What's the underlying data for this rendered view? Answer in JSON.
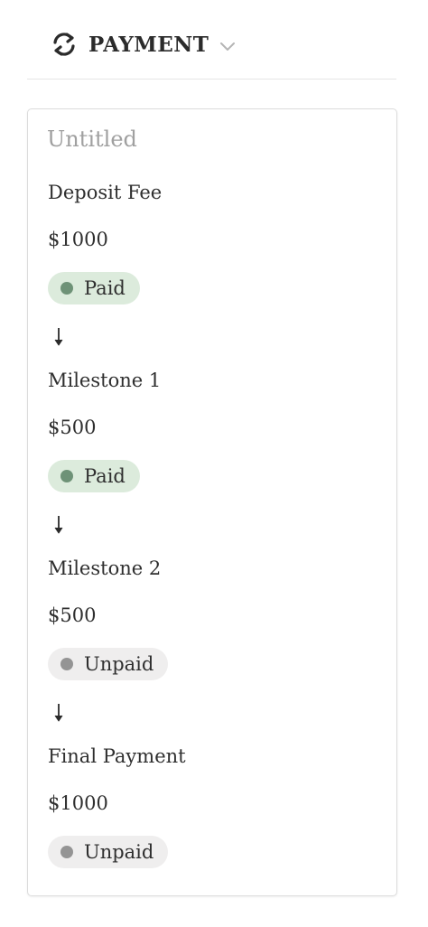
{
  "header": {
    "title": "PAYMENT",
    "icon": "sync-icon",
    "dropdown_icon": "chevron-down-icon"
  },
  "card": {
    "title": "Untitled",
    "steps": [
      {
        "label": "Deposit Fee",
        "amount": "$1000",
        "status": "Paid"
      },
      {
        "label": "Milestone 1",
        "amount": "$500",
        "status": "Paid"
      },
      {
        "label": "Milestone 2",
        "amount": "$500",
        "status": "Unpaid"
      },
      {
        "label": "Final Payment",
        "amount": "$1000",
        "status": "Unpaid"
      }
    ],
    "connector_icon": "arrow-down-icon"
  },
  "colors": {
    "paid_bg": "#dcebdc",
    "paid_dot": "#6e9277",
    "unpaid_bg": "#efeeee",
    "unpaid_dot": "#949494",
    "title_muted": "#a0a0a0"
  }
}
